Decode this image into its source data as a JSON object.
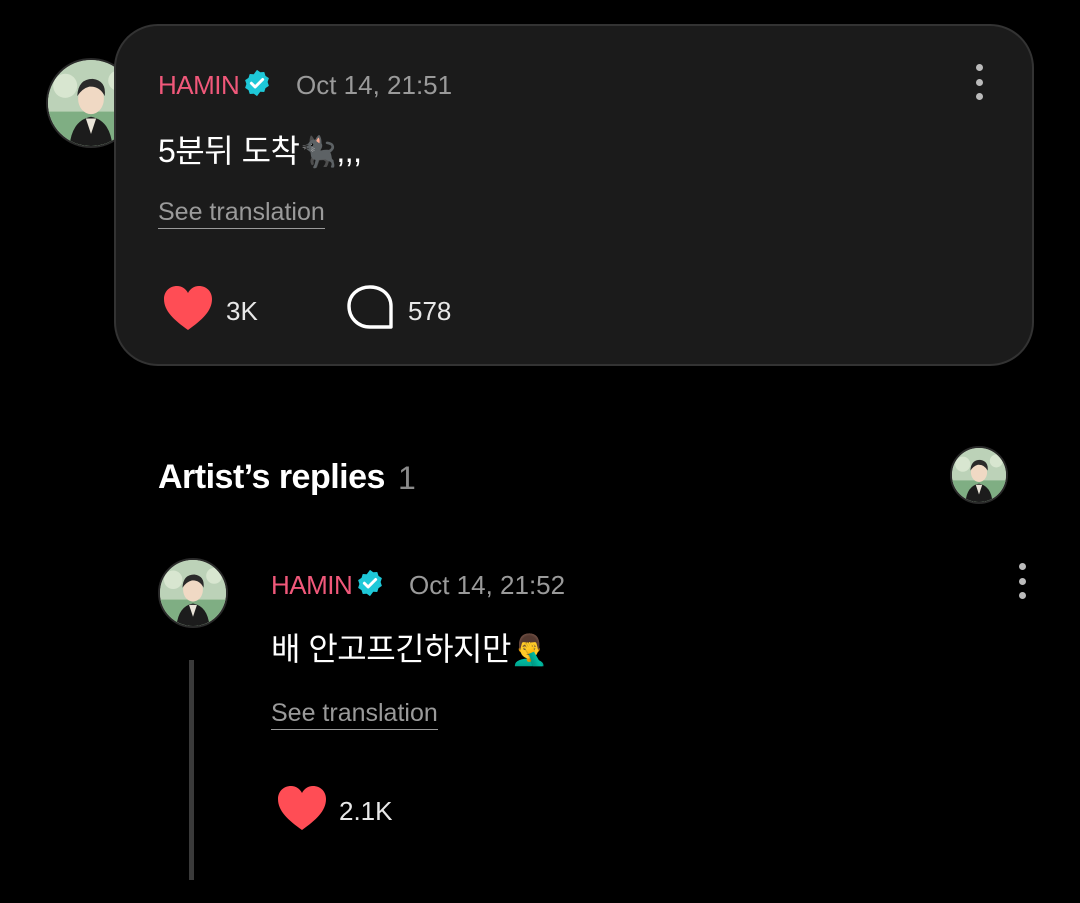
{
  "post": {
    "author": "HAMIN",
    "verified": true,
    "timestamp": "Oct 14, 21:51",
    "text": "5분뒤 도착",
    "text_emoji": "🐈‍⬛",
    "text_suffix": ",,,",
    "see_translation": "See translation",
    "likes": "3K",
    "comments": "578"
  },
  "replies_section": {
    "title": "Artist’s replies",
    "count": "1"
  },
  "reply": {
    "author": "HAMIN",
    "verified": true,
    "timestamp": "Oct 14, 21:52",
    "text": "배 안고프긴하지만",
    "text_emoji": "🤦‍♂️",
    "see_translation": "See translation",
    "likes": "2.1K"
  },
  "colors": {
    "name": "#f0587a",
    "verified_badge": "#1ec8d8",
    "heart": "#ff4d55",
    "card_bg": "#1b1b1b"
  },
  "icons": [
    "avatar",
    "verified-icon",
    "more-vertical-icon",
    "heart-icon",
    "comment-bubble-icon"
  ]
}
